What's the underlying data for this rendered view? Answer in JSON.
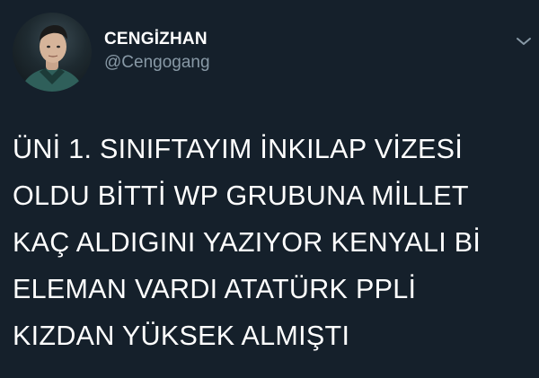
{
  "tweet": {
    "author": {
      "display_name": "CENGİZHAN",
      "handle": "@Cengogang"
    },
    "text_lines": [
      "ÜNİ 1. SINIFTAYIM İNKILAP VİZESİ",
      "OLDU BİTTİ WP GRUBUNA MİLLET",
      "KAÇ ALDIGINI YAZIYOR KENYALI Bİ",
      "ELEMAN VARDI ATATÜRK PPLİ",
      "KIZDAN YÜKSEK ALMIŞTI"
    ]
  },
  "icons": {
    "more": "chevron-down-icon",
    "avatar": "profile-photo"
  },
  "colors": {
    "background": "#15202b",
    "text": "#ffffff",
    "handle": "#8899a6",
    "chevron": "#8899a6"
  }
}
